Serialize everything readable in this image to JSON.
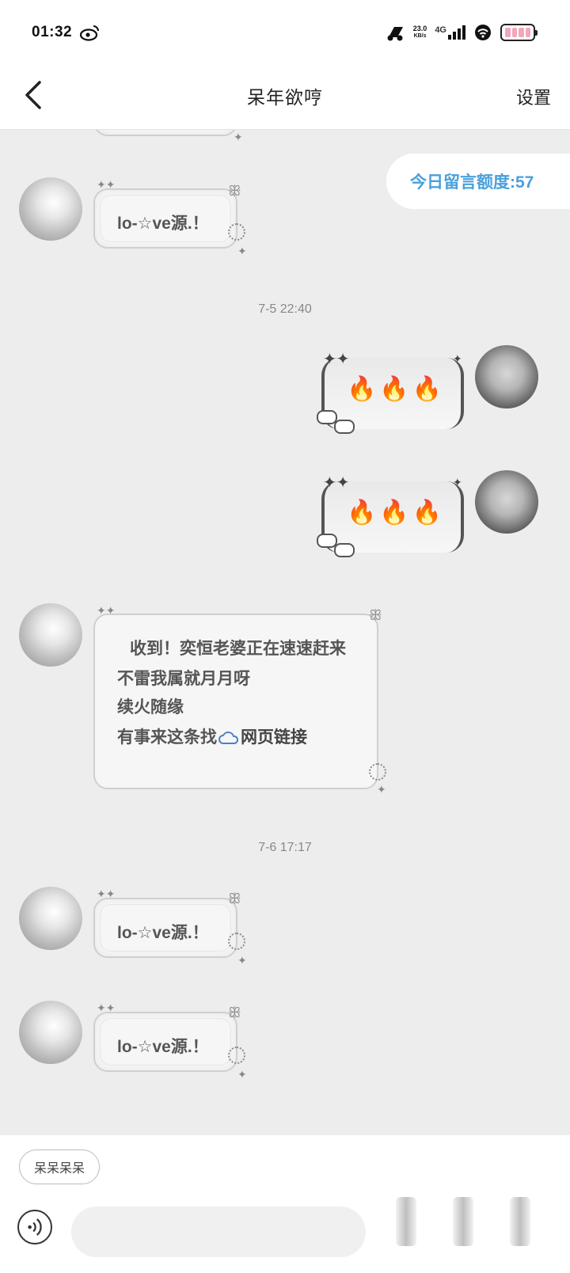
{
  "status_bar": {
    "time": "01:32",
    "net_speed": "23.0",
    "net_unit": "KB/s",
    "network": "4G"
  },
  "header": {
    "title": "呆年欲哼",
    "settings_label": "设置"
  },
  "quota": {
    "text": "今日留言额度:57"
  },
  "messages": [
    {
      "text": "lo-☆ve源.！"
    },
    {
      "timestamp": "7-5  22:40"
    },
    {
      "emoji": "🔥🔥🔥"
    },
    {
      "emoji": "🔥🔥🔥"
    },
    {
      "line1": "收到！奕恒老婆正在速速赶来",
      "line2": "不雷我属就月月呀",
      "line3": "续火随缘",
      "line4_prefix": "有事来这条找",
      "line4_link": "网页链接"
    },
    {
      "timestamp": "7-6  17:17"
    },
    {
      "text": "lo-☆ve源.！"
    },
    {
      "text": "lo-☆ve源.！"
    }
  ],
  "bottom": {
    "quick_reply": "呆呆呆呆",
    "input_placeholder": ""
  },
  "colors": {
    "accent_blue": "#4aa0dc",
    "battery_pink": "#f3a7b9"
  }
}
